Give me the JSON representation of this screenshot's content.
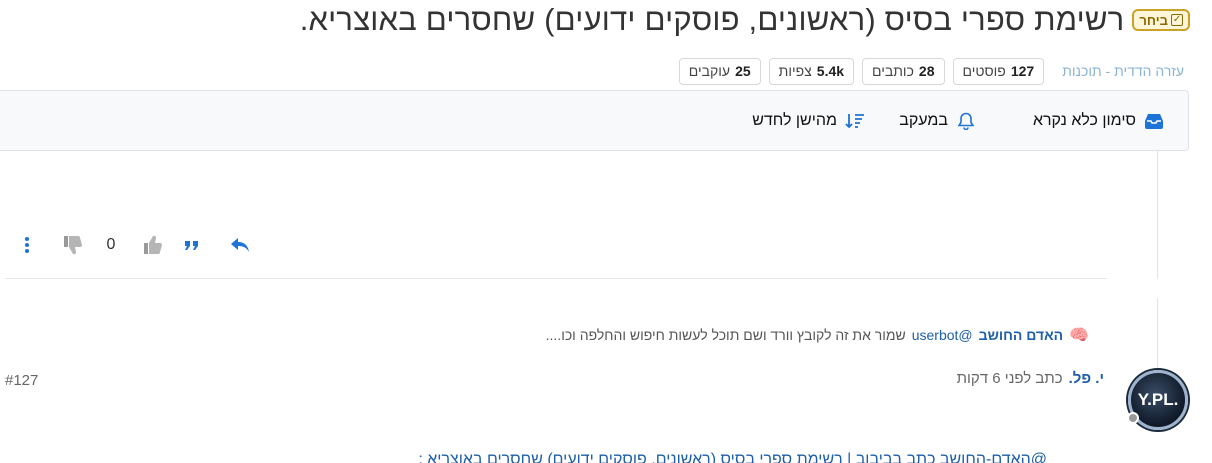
{
  "topic": {
    "solved_label": "ביחר",
    "title": "רשימת ספרי בסיס (ראשונים, פוסקים ידועים) שחסרים באוצריא."
  },
  "stats": {
    "category": "עזרה הדדית - תוכנות",
    "posts_value": "127",
    "posts_label": "פוסטים",
    "writers_value": "28",
    "writers_label": "כותבים",
    "views_value": "5.4k",
    "views_label": "צפיות",
    "followers_value": "25",
    "followers_label": "עוקבים"
  },
  "toolbar": {
    "mark_unread_label": "סימון כלא נקרא",
    "tracking_label": "במעקב",
    "sort_label": "מהישן לחדש"
  },
  "post_actions": {
    "vote_count": "0"
  },
  "mention": {
    "author": "האדם החושב",
    "handle": "@userbot",
    "snippet": "שמור את זה לקובץ וורד ושם תוכל לעשות חיפוש והחלפה וכו...."
  },
  "post": {
    "author": "י. פל.",
    "meta": "כתב לפני 6 דקות",
    "number": "#127",
    "avatar_text": "Y.PL.",
    "quote_line": "@האדם-החושב כתב בביבוב | רשימת ספרי בסיס (ראשונים, פוסקים ידועים) שחסרים באוצריא :"
  },
  "colors": {
    "accent": "#1e73d6",
    "link": "#1e5fa8",
    "solved_border": "#c9a227"
  }
}
